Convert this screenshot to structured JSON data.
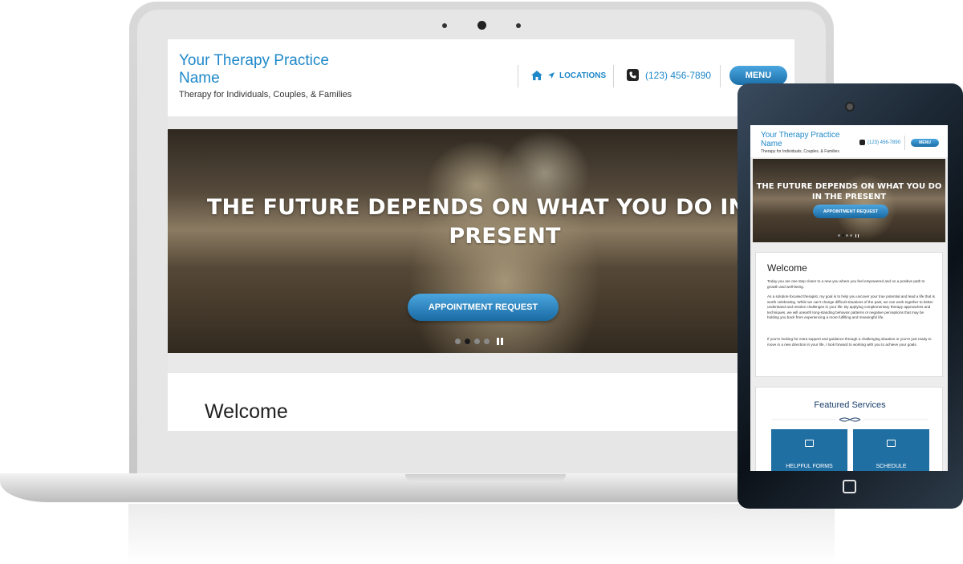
{
  "site": {
    "name": "Your Therapy Practice Name",
    "tagline": "Therapy for Individuals, Couples, & Families",
    "nav": {
      "home_icon": "home-icon",
      "locations_label": "LOCATIONS",
      "phone": "(123) 456-7890",
      "menu_label": "MENU"
    },
    "hero": {
      "headline": "THE FUTURE DEPENDS ON WHAT YOU DO IN THE PRESENT",
      "cta_label": "APPOINTMENT REQUEST",
      "slide_count": 4,
      "active_slide": 2
    },
    "welcome": {
      "title": "Welcome",
      "paragraphs": [
        "Today you are one step closer to a new you where you feel empowered and on a positive path to growth and well-being.",
        "As a solution-focused therapist, my goal is to help you uncover your true potential and lead a life that is worth celebrating. While we can't change difficult situations of the past, we can work together to better understand and resolve challenges in your life. By applying complementary therapy approaches and techniques, we will unearth long-standing behavior patterns or negative perceptions that may be holding you back from experiencing a more fulfilling and meaningful life.",
        "If you're looking for extra support and guidance through a challenging situation or you're just ready to move in a new direction in your life, I look forward to working with you to achieve your goals."
      ]
    },
    "services": {
      "title": "Featured Services",
      "items": [
        {
          "label": "HELPFUL FORMS",
          "icon": "forms-icon"
        },
        {
          "label": "SCHEDULE",
          "icon": "calendar-icon"
        }
      ]
    }
  },
  "colors": {
    "brand_blue": "#1f88c9",
    "button_blue": "#2a86c7",
    "service_tile": "#206fa3",
    "services_heading": "#1b3f6b"
  }
}
